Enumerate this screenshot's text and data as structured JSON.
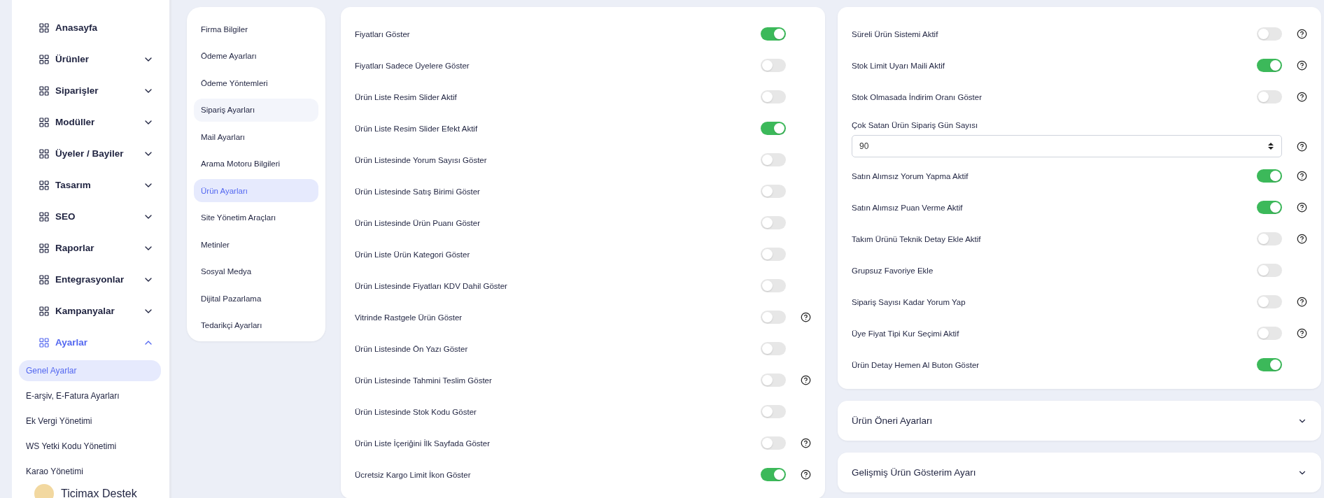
{
  "sidebar": {
    "items": [
      {
        "label": "Anasayfa",
        "kind": "link",
        "selected": false
      },
      {
        "label": "Ürünler",
        "kind": "group",
        "expanded": false,
        "selected": false
      },
      {
        "label": "Siparişler",
        "kind": "group",
        "expanded": false,
        "selected": false
      },
      {
        "label": "Modüller",
        "kind": "group",
        "expanded": false,
        "selected": false
      },
      {
        "label": "Üyeler / Bayiler",
        "kind": "group",
        "expanded": false,
        "selected": false
      },
      {
        "label": "Tasarım",
        "kind": "group",
        "expanded": false,
        "selected": false
      },
      {
        "label": "SEO",
        "kind": "group",
        "expanded": false,
        "selected": false
      },
      {
        "label": "Raporlar",
        "kind": "group",
        "expanded": false,
        "selected": false
      },
      {
        "label": "Entegrasyonlar",
        "kind": "group",
        "expanded": false,
        "selected": false
      },
      {
        "label": "Kampanyalar",
        "kind": "group",
        "expanded": false,
        "selected": false
      },
      {
        "label": "Ayarlar",
        "kind": "group",
        "expanded": true,
        "selected": true,
        "children": [
          {
            "label": "Genel Ayarlar",
            "selected": true
          },
          {
            "label": "E-arşiv, E-Fatura Ayarları",
            "selected": false
          },
          {
            "label": "Ek Vergi Yönetimi",
            "selected": false
          },
          {
            "label": "WS Yetki Kodu Yönetimi",
            "selected": false
          },
          {
            "label": "Karao Yönetimi",
            "selected": false
          }
        ]
      }
    ],
    "user": {
      "name": "Ticimax Destek"
    }
  },
  "settings_menu": {
    "items": [
      {
        "label": "Firma Bilgiler",
        "selected": false,
        "hovered": false
      },
      {
        "label": "Ödeme Ayarları",
        "selected": false,
        "hovered": false
      },
      {
        "label": "Ödeme Yöntemleri",
        "selected": false,
        "hovered": false
      },
      {
        "label": "Sipariş Ayarları",
        "selected": false,
        "hovered": true
      },
      {
        "label": "Mail Ayarları",
        "selected": false,
        "hovered": false
      },
      {
        "label": "Arama Motoru Bilgileri",
        "selected": false,
        "hovered": false
      },
      {
        "label": "Ürün Ayarları",
        "selected": true,
        "hovered": false
      },
      {
        "label": "Site Yönetim Araçları",
        "selected": false,
        "hovered": false
      },
      {
        "label": "Metinler",
        "selected": false,
        "hovered": false
      },
      {
        "label": "Sosyal Medya",
        "selected": false,
        "hovered": false
      },
      {
        "label": "Dijital Pazarlama",
        "selected": false,
        "hovered": false
      },
      {
        "label": "Tedarikçi Ayarları",
        "selected": false,
        "hovered": false
      }
    ]
  },
  "product_settings_left": {
    "rows": [
      {
        "kind": "toggle",
        "label": "Fiyatları Göster",
        "on": true,
        "help": false
      },
      {
        "kind": "toggle",
        "label": "Fiyatları Sadece Üyelere Göster",
        "on": false,
        "help": false
      },
      {
        "kind": "toggle",
        "label": "Ürün Liste Resim Slider Aktif",
        "on": false,
        "help": false
      },
      {
        "kind": "toggle",
        "label": "Ürün Liste Resim Slider Efekt Aktif",
        "on": true,
        "help": false
      },
      {
        "kind": "toggle",
        "label": "Ürün Listesinde Yorum Sayısı Göster",
        "on": false,
        "help": false
      },
      {
        "kind": "toggle",
        "label": "Ürün Listesinde Satış Birimi Göster",
        "on": false,
        "help": false
      },
      {
        "kind": "toggle",
        "label": "Ürün Listesinde Ürün Puanı Göster",
        "on": false,
        "help": false
      },
      {
        "kind": "toggle",
        "label": "Ürün Liste Ürün Kategori Göster",
        "on": false,
        "help": false
      },
      {
        "kind": "toggle",
        "label": "Ürün Listesinde Fiyatları KDV Dahil Göster",
        "on": false,
        "help": false
      },
      {
        "kind": "toggle",
        "label": "Vitrinde Rastgele Ürün Göster",
        "on": false,
        "help": true
      },
      {
        "kind": "toggle",
        "label": "Ürün Listesinde Ön Yazı Göster",
        "on": false,
        "help": false
      },
      {
        "kind": "toggle",
        "label": "Ürün Listesinde Tahmini Teslim Göster",
        "on": false,
        "help": true
      },
      {
        "kind": "toggle",
        "label": "Ürün Listesinde Stok Kodu Göster",
        "on": false,
        "help": false
      },
      {
        "kind": "toggle",
        "label": "Ürün Liste İçeriğini İlk Sayfada Göster",
        "on": false,
        "help": true
      },
      {
        "kind": "toggle",
        "label": "Ücretsiz Kargo Limit İkon Göster",
        "on": true,
        "help": true
      }
    ]
  },
  "product_settings_right": {
    "rows": [
      {
        "kind": "toggle",
        "label": "Süreli Ürün Sistemi Aktif",
        "on": false,
        "help": true
      },
      {
        "kind": "toggle",
        "label": "Stok Limit Uyarı Maili Aktif",
        "on": true,
        "help": true
      },
      {
        "kind": "toggle",
        "label": "Stok Olmasada İndirim Oranı Göster",
        "on": false,
        "help": true
      },
      {
        "kind": "number",
        "label": "Çok Satan Ürün Sipariş Gün Sayısı",
        "value": "90",
        "help": true
      },
      {
        "kind": "toggle",
        "label": "Satın Alımsız Yorum Yapma Aktif",
        "on": true,
        "help": true
      },
      {
        "kind": "toggle",
        "label": "Satın Alımsız Puan Verme Aktif",
        "on": true,
        "help": true
      },
      {
        "kind": "toggle",
        "label": "Takım Ürünü Teknik Detay Ekle Aktif",
        "on": false,
        "help": true
      },
      {
        "kind": "toggle",
        "label": "Grupsuz Favoriye Ekle",
        "on": false,
        "help": false
      },
      {
        "kind": "toggle",
        "label": "Sipariş Sayısı Kadar Yorum Yap",
        "on": false,
        "help": true
      },
      {
        "kind": "toggle",
        "label": "Üye Fiyat Tipi Kur Seçimi Aktif",
        "on": false,
        "help": true
      },
      {
        "kind": "toggle",
        "label": "Ürün Detay Hemen Al Buton Göster",
        "on": true,
        "help": false
      }
    ]
  },
  "accordions": [
    {
      "title": "Ürün Öneri Ayarları",
      "expanded": false
    },
    {
      "title": "Gelişmiş Ürün Gösterim Ayarı",
      "expanded": false
    }
  ]
}
